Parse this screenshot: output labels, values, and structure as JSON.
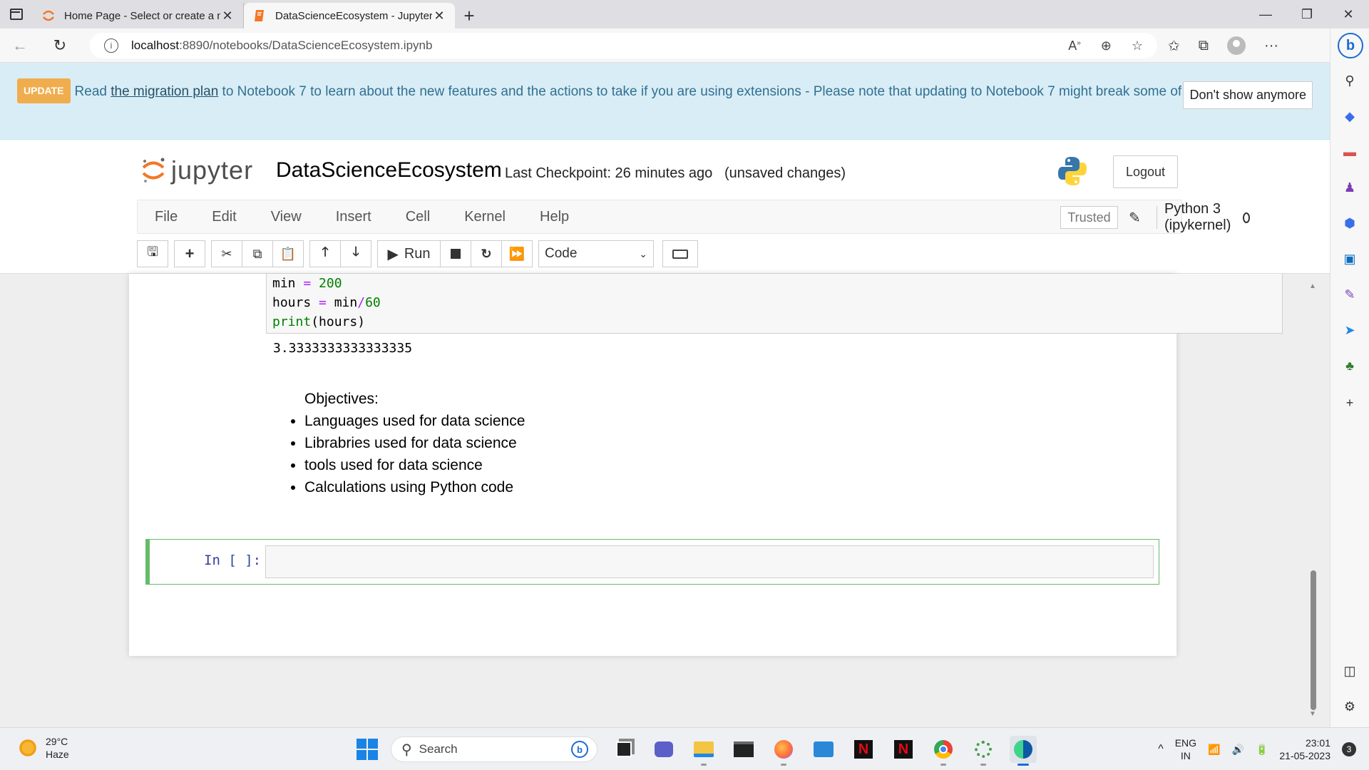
{
  "browser": {
    "tabs": [
      {
        "title": "Home Page - Select or create a n",
        "active": false,
        "icon": "jupyter-icon"
      },
      {
        "title": "DataScienceEcosystem - Jupyter",
        "active": true,
        "icon": "notebook-icon"
      }
    ],
    "address": {
      "host": "localhost",
      "path": ":8890/notebooks/DataScienceEcosystem.ipynb"
    }
  },
  "banner": {
    "badge": "UPDATE",
    "text_before": "Read ",
    "link": "the migration plan",
    "text_after": " to Notebook 7 to learn about the new features and the actions to take if you are using extensions - Please note that updating to Notebook 7 might break some of your extensions.",
    "dismiss": "Don't show anymore"
  },
  "header": {
    "logo_text": "jupyter",
    "notebook_name": "DataScienceEcosystem",
    "checkpoint": "Last Checkpoint: 26 minutes ago",
    "unsaved": "(unsaved changes)",
    "logout": "Logout"
  },
  "menu": {
    "items": [
      "File",
      "Edit",
      "View",
      "Insert",
      "Cell",
      "Kernel",
      "Help"
    ],
    "trusted": "Trusted",
    "kernel_name": "Python 3 (ipykernel)"
  },
  "toolbar": {
    "run_label": "Run",
    "cell_type": "Code"
  },
  "notebook": {
    "code_lines": [
      {
        "a": "min",
        "b": " = ",
        "c": "200"
      },
      {
        "a": "hours",
        "b": " = ",
        "c": "min",
        "d": "/",
        "e": "60"
      },
      {
        "a": "print",
        "b": "(hours)"
      }
    ],
    "output": "3.3333333333333335",
    "markdown_title": "Objectives:",
    "markdown_items": [
      "Languages used for data science",
      "Librabries used for data science",
      "tools used for data science",
      "Calculations using Python code"
    ],
    "prompt": "In [ ]:"
  },
  "taskbar": {
    "temperature": "29°C",
    "weather": "Haze",
    "search_placeholder": "Search",
    "lang_top": "ENG",
    "lang_bottom": "IN",
    "time": "23:01",
    "date": "21-05-2023",
    "notifications": "3"
  }
}
